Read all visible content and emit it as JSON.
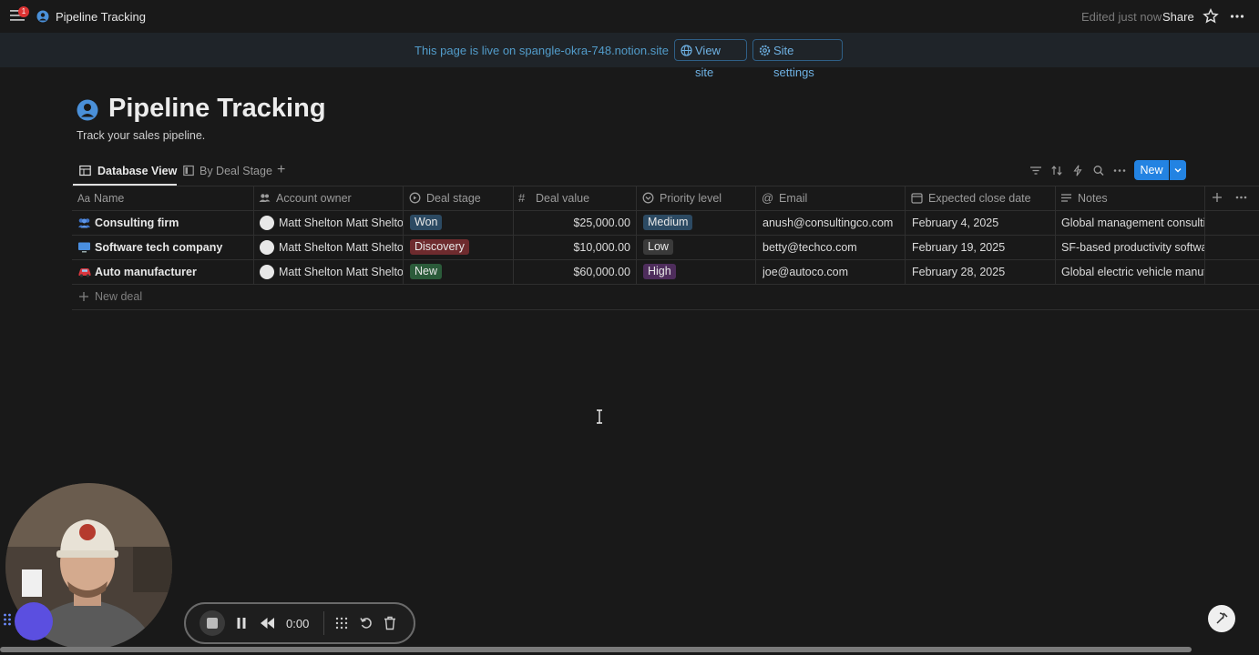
{
  "topbar": {
    "notification_count": "1",
    "breadcrumb": "Pipeline Tracking",
    "edited": "Edited just now",
    "share": "Share"
  },
  "banner": {
    "text": "This page is live on spangle-okra-748.notion.site",
    "view_site": "View site",
    "site_settings": "Site settings"
  },
  "page": {
    "title": "Pipeline Tracking",
    "description": "Track your sales pipeline."
  },
  "tabs": {
    "database_view": "Database View",
    "by_deal_stage": "By Deal Stage",
    "add": "+"
  },
  "toolbar": {
    "new": "New"
  },
  "table": {
    "columns": [
      "Name",
      "Account owner",
      "Deal stage",
      "Deal value",
      "Priority level",
      "Email",
      "Expected close date",
      "Notes"
    ],
    "name_prefix": "Aa",
    "rows": [
      {
        "icon": "people-icon",
        "name": "Consulting firm",
        "owner": "Matt Shelton Matt Shelton",
        "stage": "Won",
        "value": "$25,000.00",
        "priority": "Medium",
        "email": "anush@consultingco.com",
        "close": "February 4, 2025",
        "notes": "Global management consulting"
      },
      {
        "icon": "computer-icon",
        "name": "Software tech company",
        "owner": "Matt Shelton Matt Shelton",
        "stage": "Discovery",
        "value": "$10,000.00",
        "priority": "Low",
        "email": "betty@techco.com",
        "close": "February 19, 2025",
        "notes": "SF-based productivity software"
      },
      {
        "icon": "car-icon",
        "name": "Auto manufacturer",
        "owner": "Matt Shelton Matt Shelton",
        "stage": "New",
        "value": "$60,000.00",
        "priority": "High",
        "email": "joe@autoco.com",
        "close": "February 28, 2025",
        "notes": "Global electric vehicle manufacturer"
      }
    ],
    "new_row": "New deal"
  },
  "recording": {
    "timer": "0:00"
  },
  "colors": {
    "stage_won": "#2c4a63",
    "stage_discovery": "#6e2b2e",
    "stage_new": "#2b5b3a",
    "priority_medium": "#2c4a63",
    "priority_low": "#3a3a3a",
    "priority_high": "#4e2d5c",
    "accent": "#2383e2"
  }
}
